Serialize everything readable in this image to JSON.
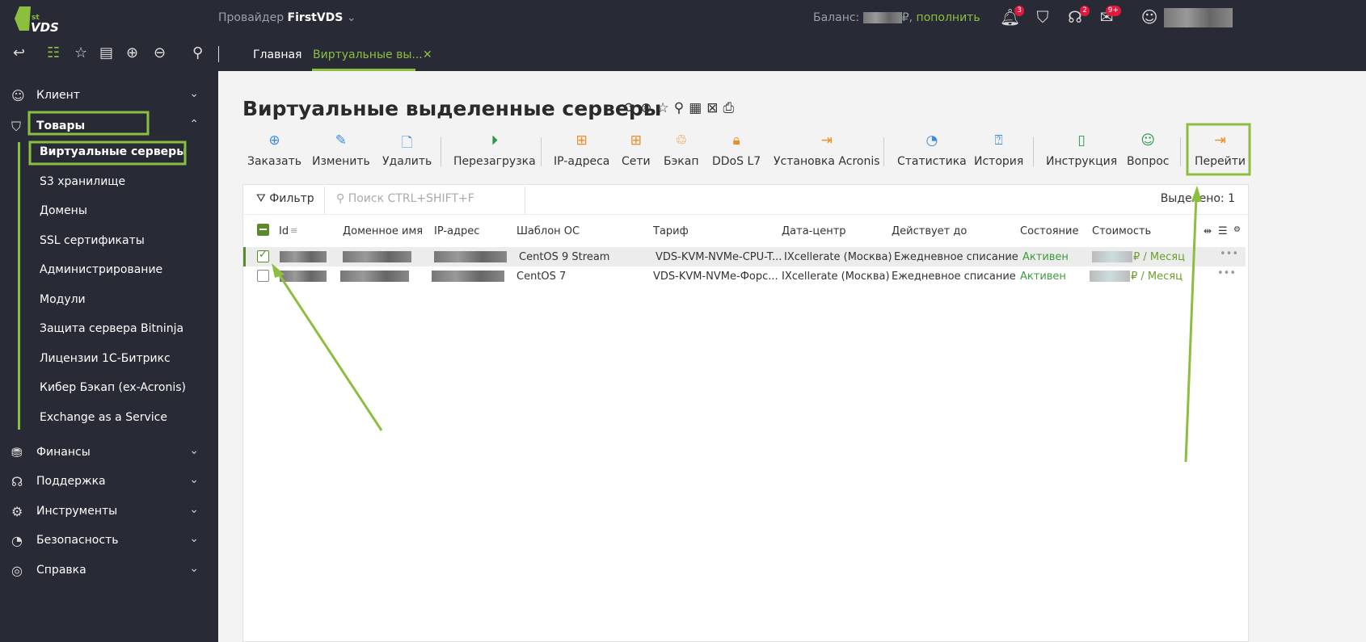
{
  "header": {
    "logo_text": "1st VDS",
    "provider_label": "Провайдер",
    "provider_name": "FirstVDS",
    "balance_label": "Баланс:",
    "balance_currency": "₽,",
    "topup_link": "пополнить",
    "notifications": {
      "bell": "3",
      "support": "2",
      "mail": "9+"
    }
  },
  "toolbar": {
    "tabs": [
      {
        "label": "Главная"
      },
      {
        "label": "Виртуальные вы..."
      }
    ]
  },
  "sidebar": {
    "items": [
      {
        "label": "Клиент"
      },
      {
        "label": "Товары"
      },
      {
        "label": "Финансы"
      },
      {
        "label": "Поддержка"
      },
      {
        "label": "Инструменты"
      },
      {
        "label": "Безопасность"
      },
      {
        "label": "Справка"
      }
    ],
    "sub": [
      {
        "label": "Виртуальные серверы"
      },
      {
        "label": "S3 хранилище"
      },
      {
        "label": "Домены"
      },
      {
        "label": "SSL сертификаты"
      },
      {
        "label": "Администрирование"
      },
      {
        "label": "Модули"
      },
      {
        "label": "Защита сервера Bitninja"
      },
      {
        "label": "Лицензии 1С-Битрикс"
      },
      {
        "label": "Кибер Бэкап (ex-Acronis)"
      },
      {
        "label": "Exchange as a Service"
      }
    ]
  },
  "main": {
    "title": "Виртуальные выделенные серверы",
    "actions": [
      {
        "label": "Заказать"
      },
      {
        "label": "Изменить"
      },
      {
        "label": "Удалить"
      },
      {
        "label": "Перезагрузка"
      },
      {
        "label": "IP-адреса"
      },
      {
        "label": "Сети"
      },
      {
        "label": "Бэкап"
      },
      {
        "label": "DDoS L7"
      },
      {
        "label": "Установка Acronis"
      },
      {
        "label": "Статистика"
      },
      {
        "label": "История"
      },
      {
        "label": "Инструкция"
      },
      {
        "label": "Вопрос"
      },
      {
        "label": "Перейти"
      }
    ],
    "filter_label": "Фильтр",
    "search_placeholder": "Поиск CTRL+SHIFT+F",
    "selected": "Выделено: 1",
    "columns": [
      "Id",
      "Доменное имя",
      "IP-адрес",
      "Шаблон ОС",
      "Тариф",
      "Дата-центр",
      "Действует до",
      "Состояние",
      "Стоимость"
    ],
    "rows": [
      {
        "os": "CentOS 9 Stream",
        "tariff": "VDS-KVM-NVMe-CPU-T...",
        "dc": "IXcellerate (Москва)",
        "until": "Ежедневное списание",
        "status": "Активен",
        "price": "₽ / Месяц",
        "checked": true
      },
      {
        "os": "CentOS 7",
        "tariff": "VDS-KVM-NVMe-Форс...",
        "dc": "IXcellerate (Москва)",
        "until": "Ежедневное списание",
        "status": "Активен",
        "price": "₽ / Месяц",
        "checked": false
      }
    ]
  },
  "colors": {
    "accent": "#8cbf3f",
    "dark": "#282b36",
    "active": "#3d9a3d"
  }
}
